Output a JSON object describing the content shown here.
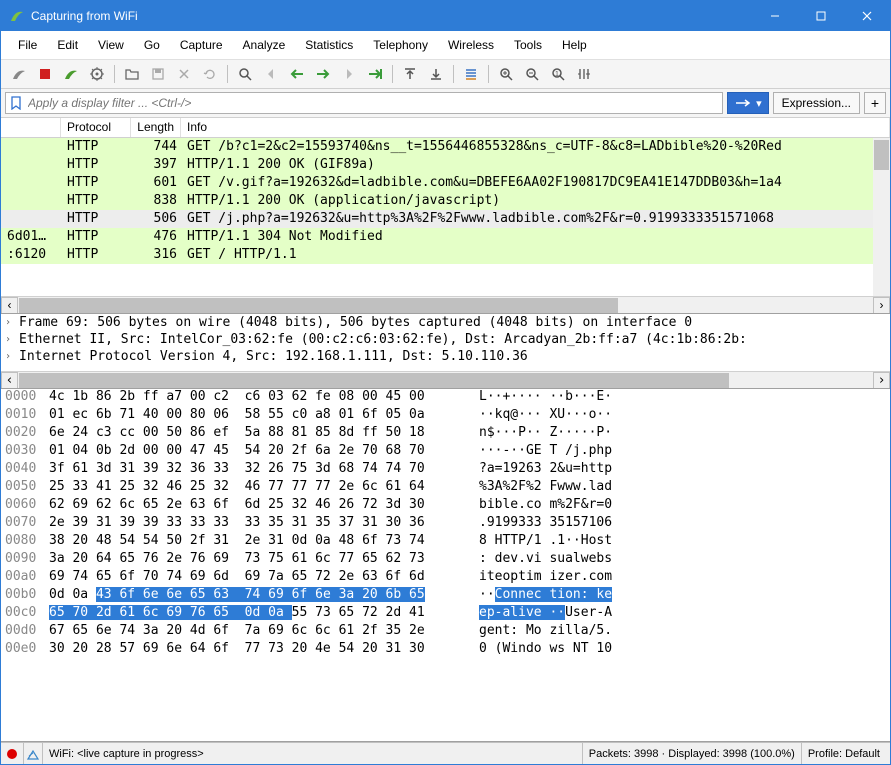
{
  "window": {
    "title": "Capturing from WiFi"
  },
  "menu": [
    "File",
    "Edit",
    "View",
    "Go",
    "Capture",
    "Analyze",
    "Statistics",
    "Telephony",
    "Wireless",
    "Tools",
    "Help"
  ],
  "filter": {
    "placeholder": "Apply a display filter ... <Ctrl-/>",
    "expression_label": "Expression..."
  },
  "columns": {
    "protocol": "Protocol",
    "length": "Length",
    "info": "Info"
  },
  "packets": [
    {
      "addr": "",
      "proto": "HTTP",
      "len": "744",
      "info": "GET /b?c1=2&c2=15593740&ns__t=1556446855328&ns_c=UTF-8&c8=LADbible%20-%20Red",
      "bg": "green"
    },
    {
      "addr": "",
      "proto": "HTTP",
      "len": "397",
      "info": "HTTP/1.1 200 OK  (GIF89a)",
      "bg": "green"
    },
    {
      "addr": "",
      "proto": "HTTP",
      "len": "601",
      "info": "GET /v.gif?a=192632&d=ladbible.com&u=DBEFE6AA02F190817DC9EA41E147DDB03&h=1a4",
      "bg": "green"
    },
    {
      "addr": "",
      "proto": "HTTP",
      "len": "838",
      "info": "HTTP/1.1 200 OK  (application/javascript)",
      "bg": "green"
    },
    {
      "addr": "",
      "proto": "HTTP",
      "len": "506",
      "info": "GET /j.php?a=192632&u=http%3A%2F%2Fwww.ladbible.com%2F&r=0.9199333351571068",
      "bg": "selected"
    },
    {
      "addr": "6d01…",
      "proto": "HTTP",
      "len": "476",
      "info": "HTTP/1.1 304 Not Modified",
      "bg": "green"
    },
    {
      "addr": ":6120",
      "proto": "HTTP",
      "len": "316",
      "info": "GET / HTTP/1.1",
      "bg": "green"
    }
  ],
  "details": [
    "Frame 69: 506 bytes on wire (4048 bits), 506 bytes captured (4048 bits) on interface 0",
    "Ethernet II, Src: IntelCor_03:62:fe (00:c2:c6:03:62:fe), Dst: Arcadyan_2b:ff:a7 (4c:1b:86:2b:",
    "Internet Protocol Version 4, Src: 192.168.1.111, Dst: 5.10.110.36"
  ],
  "hex": [
    {
      "off": "0000",
      "hex": "4c 1b 86 2b ff a7 00 c2  c6 03 62 fe 08 00 45 00",
      "asc": "L··+···· ··b···E·"
    },
    {
      "off": "0010",
      "hex": "01 ec 6b 71 40 00 80 06  58 55 c0 a8 01 6f 05 0a",
      "asc": "··kq@··· XU···o··"
    },
    {
      "off": "0020",
      "hex": "6e 24 c3 cc 00 50 86 ef  5a 88 81 85 8d ff 50 18",
      "asc": "n$···P·· Z·····P·"
    },
    {
      "off": "0030",
      "hex": "01 04 0b 2d 00 00 47 45  54 20 2f 6a 2e 70 68 70",
      "asc": "···-··GE T /j.php"
    },
    {
      "off": "0040",
      "hex": "3f 61 3d 31 39 32 36 33  32 26 75 3d 68 74 74 70",
      "asc": "?a=19263 2&u=http"
    },
    {
      "off": "0050",
      "hex": "25 33 41 25 32 46 25 32  46 77 77 77 2e 6c 61 64",
      "asc": "%3A%2F%2 Fwww.lad"
    },
    {
      "off": "0060",
      "hex": "62 69 62 6c 65 2e 63 6f  6d 25 32 46 26 72 3d 30",
      "asc": "bible.co m%2F&r=0"
    },
    {
      "off": "0070",
      "hex": "2e 39 31 39 39 33 33 33  33 35 31 35 37 31 30 36",
      "asc": ".9199333 35157106"
    },
    {
      "off": "0080",
      "hex": "38 20 48 54 54 50 2f 31  2e 31 0d 0a 48 6f 73 74",
      "asc": "8 HTTP/1 .1··Host"
    },
    {
      "off": "0090",
      "hex": "3a 20 64 65 76 2e 76 69  73 75 61 6c 77 65 62 73",
      "asc": ": dev.vi sualwebs"
    },
    {
      "off": "00a0",
      "hex": "69 74 65 6f 70 74 69 6d  69 7a 65 72 2e 63 6f 6d",
      "asc": "iteoptim izer.com"
    },
    {
      "off": "00b0",
      "hex": "0d 0a ",
      "hex_hl": "43 6f 6e 6e 65 63  74 69 6f 6e 3a 20 6b 65",
      "asc": "··",
      "asc_hl": "Connec tion: ke"
    },
    {
      "off": "00c0",
      "hex_hl": "65 70 2d 61 6c 69 76 65  0d 0a ",
      "hex": "55 73 65 72 2d 41",
      "asc_hl": "ep-alive ··",
      "asc": "User-A"
    },
    {
      "off": "00d0",
      "hex": "67 65 6e 74 3a 20 4d 6f  7a 69 6c 6c 61 2f 35 2e",
      "asc": "gent: Mo zilla/5."
    },
    {
      "off": "00e0",
      "hex": "30 20 28 57 69 6e 64 6f  77 73 20 4e 54 20 31 30",
      "asc": "0 (Windo ws NT 10"
    }
  ],
  "status": {
    "capture": "WiFi: <live capture in progress>",
    "packets": "Packets: 3998 · Displayed: 3998 (100.0%)",
    "profile": "Profile: Default"
  },
  "colors": {
    "accent": "#2e7cd6"
  },
  "icons": {
    "toolbar": [
      "start-capture",
      "stop-capture",
      "restart-capture",
      "options",
      "sep",
      "open",
      "save",
      "close",
      "reload",
      "sep",
      "find",
      "back-grey",
      "back",
      "forward",
      "forward-grey",
      "jump",
      "sep",
      "first",
      "last",
      "sep",
      "auto-scroll",
      "sep",
      "zoom-in",
      "zoom-out",
      "zoom-reset",
      "resize-cols"
    ]
  }
}
